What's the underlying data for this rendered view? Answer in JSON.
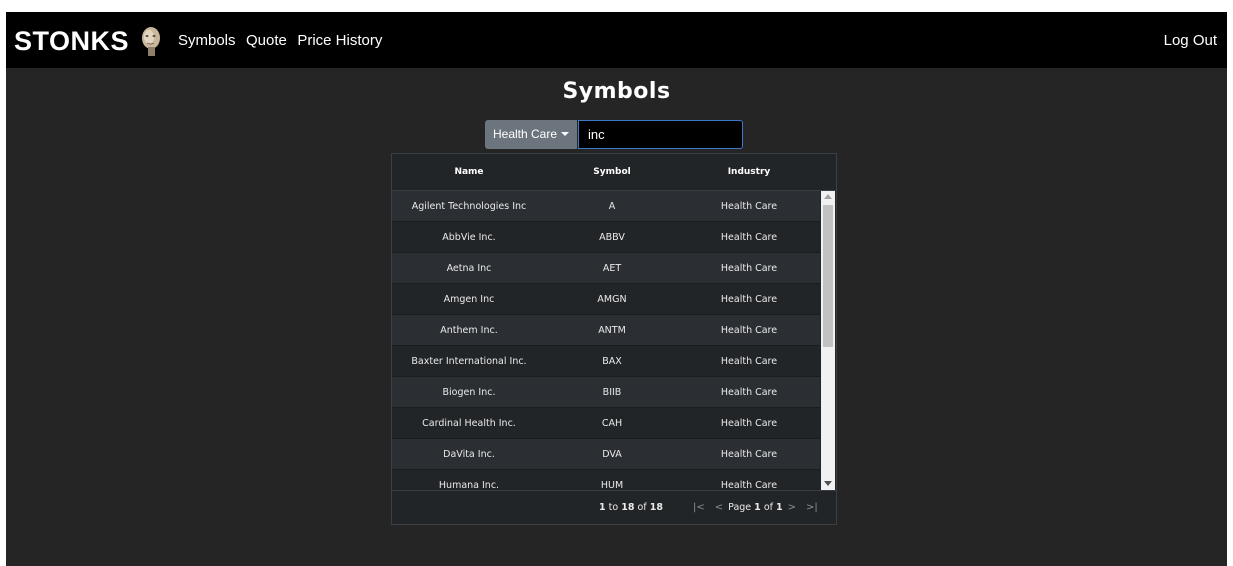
{
  "navbar": {
    "brand": "STONKS",
    "links": [
      "Symbols",
      "Quote",
      "Price History"
    ],
    "logout": "Log Out"
  },
  "page": {
    "title": "Symbols"
  },
  "filter": {
    "industry_selected": "Health Care",
    "search_value": "inc"
  },
  "table": {
    "columns": [
      "Name",
      "Symbol",
      "Industry"
    ],
    "rows": [
      [
        "Agilent Technologies Inc",
        "A",
        "Health Care"
      ],
      [
        "AbbVie Inc.",
        "ABBV",
        "Health Care"
      ],
      [
        "Aetna Inc",
        "AET",
        "Health Care"
      ],
      [
        "Amgen Inc",
        "AMGN",
        "Health Care"
      ],
      [
        "Anthem Inc.",
        "ANTM",
        "Health Care"
      ],
      [
        "Baxter International Inc.",
        "BAX",
        "Health Care"
      ],
      [
        "Biogen Inc.",
        "BIIB",
        "Health Care"
      ],
      [
        "Cardinal Health Inc.",
        "CAH",
        "Health Care"
      ],
      [
        "DaVita Inc.",
        "DVA",
        "Health Care"
      ],
      [
        "Humana Inc.",
        "HUM",
        "Health Care"
      ]
    ]
  },
  "footer": {
    "summary_from": "1",
    "summary_to_word": "to",
    "summary_to": "18",
    "summary_of_word": "of",
    "summary_total": "18",
    "page_word": "Page",
    "page_current": "1",
    "page_of_word": "of",
    "page_total": "1"
  },
  "colors": {
    "background": "#252525",
    "navbar": "#000000",
    "button": "#6c757d",
    "input_border": "#3d78c9"
  }
}
